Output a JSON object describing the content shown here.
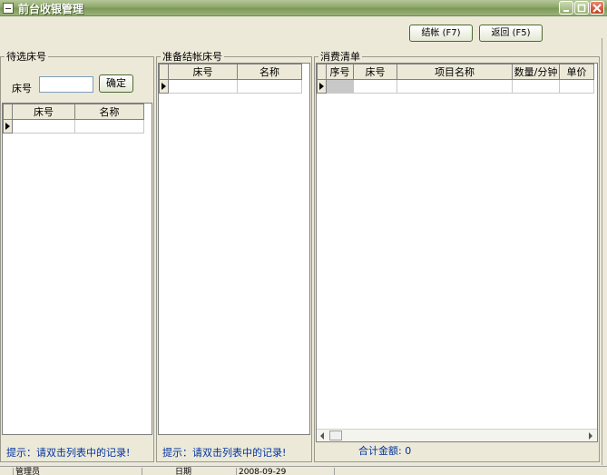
{
  "window": {
    "title": "前台收银管理"
  },
  "toolbar": {
    "checkout_label": "结帐 (F7)",
    "back_label": "返回 (F5)"
  },
  "left_panel": {
    "label": "待选床号",
    "bed_label": "床号",
    "bed_value": "",
    "ok_label": "确定",
    "columns": [
      "床号",
      "名称"
    ],
    "hint": "提示：请双击列表中的记录!"
  },
  "middle_panel": {
    "label": "准备结帐床号",
    "columns": [
      "床号",
      "名称"
    ],
    "hint": "提示：请双击列表中的记录!"
  },
  "right_panel": {
    "label": "消费清单",
    "columns": [
      "序号",
      "床号",
      "项目名称",
      "数量/分钟",
      "单价"
    ],
    "total_label": "合计金额:",
    "total_value": "0"
  },
  "statusbar": {
    "user_label": "管理员",
    "date_label": "日期",
    "date_value": "2008-09-29"
  }
}
